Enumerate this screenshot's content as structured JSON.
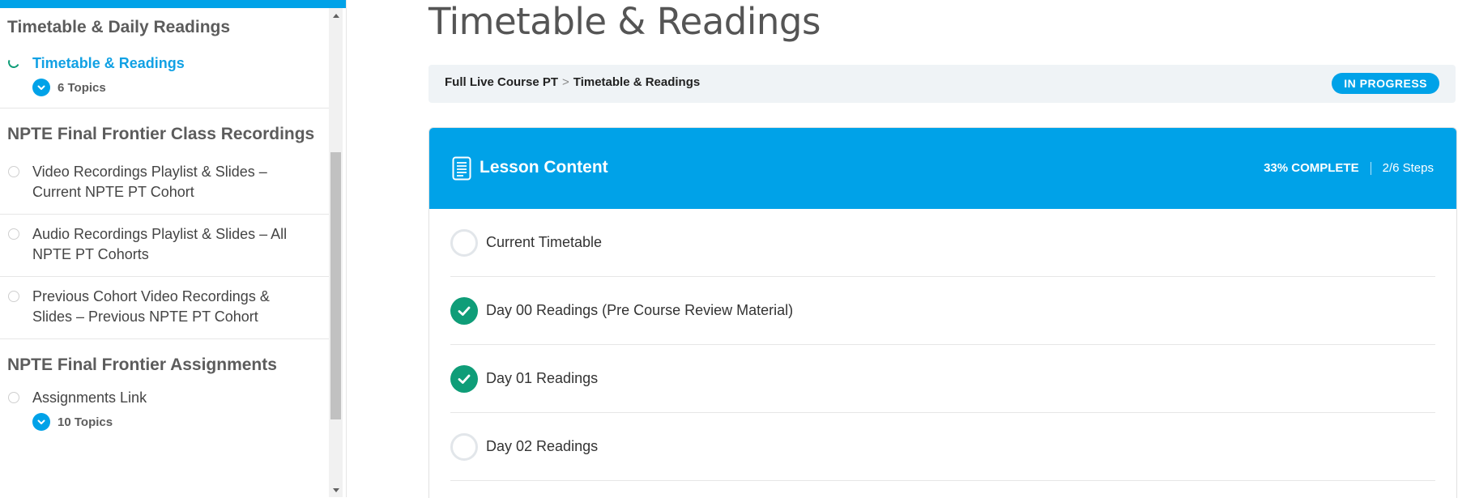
{
  "sidebar": {
    "sections": [
      {
        "title": "Timetable & Daily Readings",
        "lessons": [
          {
            "label": "Timetable & Readings",
            "status": "in-progress",
            "active": true,
            "topics": "6 Topics"
          }
        ]
      },
      {
        "title": "NPTE Final Frontier Class Recordings",
        "lessons": [
          {
            "label": "Video Recordings Playlist & Slides – Current NPTE PT Cohort",
            "status": "not-started"
          },
          {
            "label": "Audio Recordings Playlist & Slides – All NPTE PT Cohorts",
            "status": "not-started"
          },
          {
            "label": "Previous Cohort Video Recordings & Slides – Previous NPTE PT Cohort",
            "status": "not-started"
          }
        ]
      },
      {
        "title": "NPTE Final Frontier Assignments",
        "lessons": [
          {
            "label": "Assignments Link",
            "status": "not-started",
            "topics": "10 Topics"
          }
        ]
      }
    ]
  },
  "main": {
    "page_title": "Timetable & Readings",
    "breadcrumb": {
      "course": "Full Live Course PT",
      "separator": ">",
      "current": "Timetable & Readings"
    },
    "status_badge": "IN PROGRESS",
    "lesson_content": {
      "title": "Lesson Content",
      "progress_text": "33% COMPLETE",
      "steps_text": "2/6 Steps",
      "steps": [
        {
          "label": "Current Timetable",
          "complete": false
        },
        {
          "label": "Day 00 Readings (Pre Course Review Material)",
          "complete": true
        },
        {
          "label": "Day 01 Readings",
          "complete": true
        },
        {
          "label": "Day 02 Readings",
          "complete": false
        }
      ]
    }
  },
  "colors": {
    "accent": "#00a2e8",
    "complete": "#0f9d78",
    "active_link": "#11a1e4"
  }
}
